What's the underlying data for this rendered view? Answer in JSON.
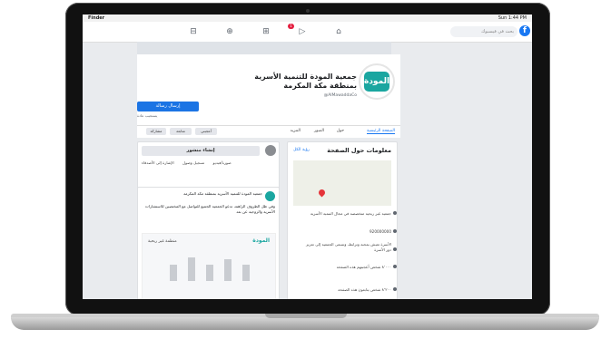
{
  "menubar": {
    "app": "Finder",
    "status": "Sun 1:44 PM"
  },
  "nav": {
    "notif_count": "1",
    "search_placeholder": "بحث في فيسبوك"
  },
  "page": {
    "name": "جمعية المودة للتنمية الأسرية بمنطقة مكة المكرمة",
    "handle": "@AlMawaddaCo",
    "subtitle": "منظمة غير ربحية",
    "message_button": "إرسال رسالة",
    "message_sub": "يستجيب عادة",
    "logo_text": "المودة"
  },
  "tabs": [
    "الصفحة الرئيسية",
    "حول",
    "الصور",
    "المزيد",
    "أعجبني",
    "متابعة",
    "مشاركة"
  ],
  "create_post": {
    "label": "إنشاء منشور",
    "options": [
      "صورة/فيديو",
      "تسجيل وصول",
      "الإشارة إلى الأصدقاء"
    ]
  },
  "about": {
    "title": "معلومات حول الصفحة",
    "edit": "رؤية الكل",
    "items": [
      "جمعية غير ربحية متخصصة في مجال التنمية الأسرية",
      "920000000",
      "الأسرة تعيش بمحبة وترابط، وتسعى الجمعية إلى تعزيز دور الأسرة",
      "٨٬٠٠٠ شخص أعجبتهم هذه الصفحة",
      "٨٬٢٠٠ شخص يتابعون هذه الصفحة"
    ]
  },
  "post": {
    "header": "جمعية المودة للتنمية الأسرية بمنطقة مكة المكرمة",
    "text": "وفي ظل الظروف الراهنة، تدعو الجمعية الجميع للتواصل مع المختصين للاستشارات الأسرية والزوجية عن بعد"
  }
}
